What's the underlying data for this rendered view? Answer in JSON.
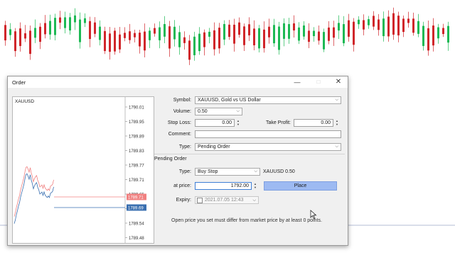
{
  "dialog": {
    "title": "Order",
    "minimize_icon": "minimize-icon",
    "maximize_icon": "maximize-icon",
    "close_icon": "close-icon"
  },
  "mini_chart": {
    "symbol": "XAUUSD",
    "price_labels": [
      "1790.01",
      "1789.95",
      "1789.89",
      "1789.83",
      "1789.77",
      "1789.71",
      "1789.65",
      "1789.60",
      "1789.54",
      "1789.48"
    ],
    "ask_label": "1789.71",
    "bid_label": "1789.69",
    "colors": {
      "ask": "#f08080",
      "bid": "#3a6fb0"
    }
  },
  "form": {
    "symbol_label": "Symbol:",
    "symbol_value": "XAUUSD, Gold vs US Dollar",
    "volume_label": "Volume:",
    "volume_value": "0.50",
    "stop_loss_label": "Stop Loss:",
    "stop_loss_value": "0.00",
    "take_profit_label": "Take Profit:",
    "take_profit_value": "0.00",
    "comment_label": "Comment:",
    "comment_value": "",
    "type_label": "Type:",
    "type_value": "Pending Order"
  },
  "pending": {
    "group_title": "Pending Order",
    "type_label": "Type:",
    "type_value": "Buy Stop",
    "instrument_info": "XAUUSD 0.50",
    "at_price_label": "at price:",
    "at_price_value": "1792.00",
    "place_label": "Place",
    "expiry_label": "Expiry:",
    "expiry_value": "2021.07.05 12:43",
    "note": "Open price you set must differ from market price by at least 0 points."
  },
  "colors": {
    "accent": "#9dbaf2",
    "bull": "#1db954",
    "bear": "#d0262a"
  }
}
